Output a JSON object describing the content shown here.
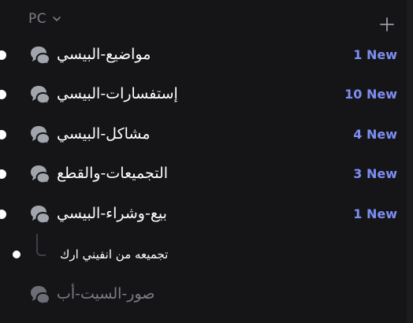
{
  "category": {
    "label": "PC",
    "expanded": true
  },
  "create_channel_icon": "plus-icon",
  "channels": [
    {
      "name": "مواضيع-البيسي",
      "badge": "1 New",
      "unread": true,
      "icon": "forum-icon"
    },
    {
      "name": "إستفسارات-البيسي",
      "badge": "10 New",
      "unread": true,
      "icon": "forum-icon"
    },
    {
      "name": "مشاكل-البيسي",
      "badge": "4 New",
      "unread": true,
      "icon": "forum-icon"
    },
    {
      "name": "التجميعات-والقطع",
      "badge": "3 New",
      "unread": true,
      "icon": "forum-icon"
    },
    {
      "name": "بيع-وشراء-البيسي",
      "badge": "1 New",
      "unread": true,
      "icon": "forum-icon"
    }
  ],
  "thread": {
    "name": "تجميعه من انفيني ارك",
    "unread": true
  },
  "muted_channel": {
    "name": "صور-السيت-أب",
    "icon": "forum-icon"
  },
  "colors": {
    "background": "#151518",
    "badge": "#7d8ef2",
    "muted_text": "#7b7c83",
    "category_text": "#7c7e87"
  }
}
